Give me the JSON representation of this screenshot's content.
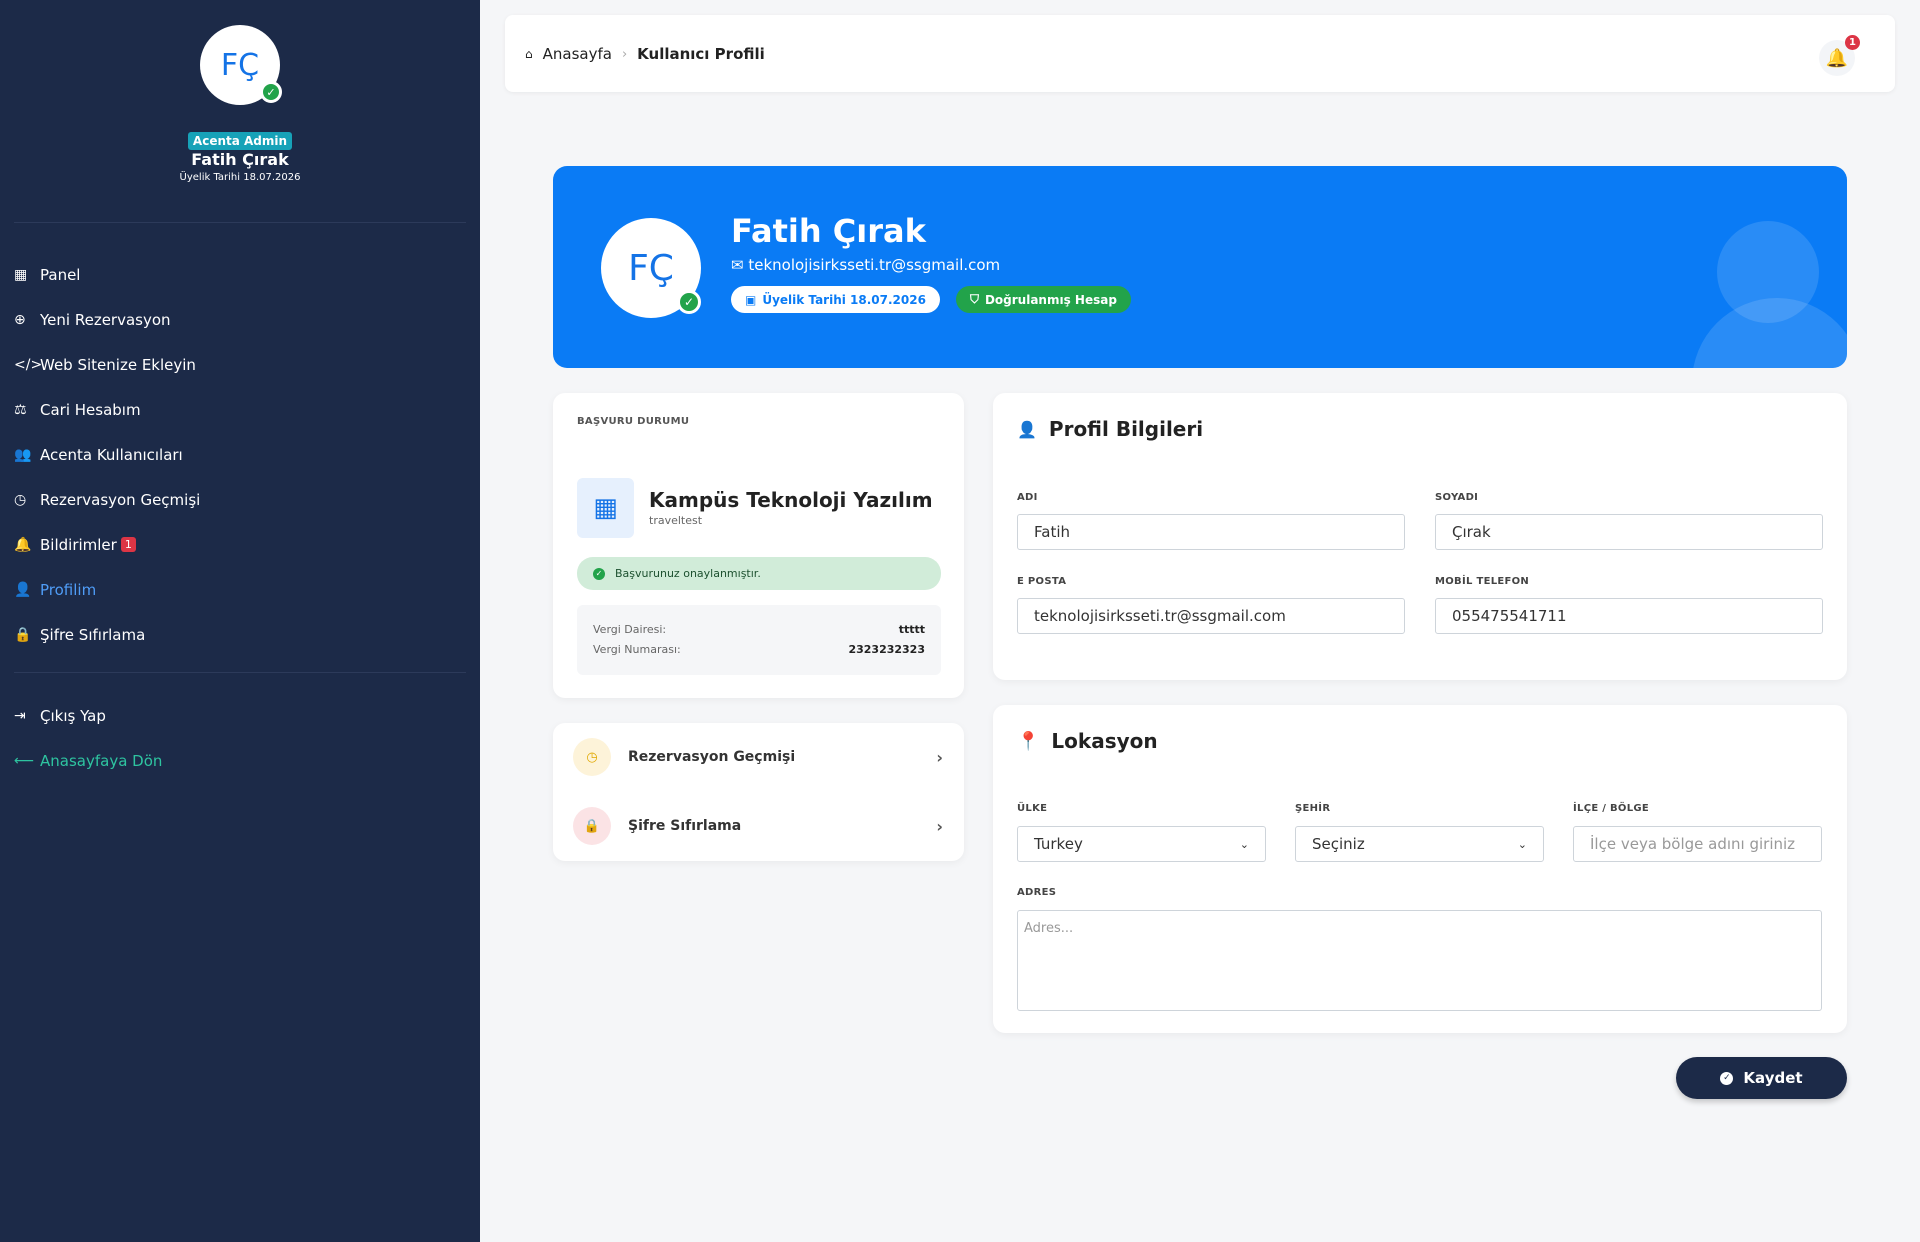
{
  "sidebar": {
    "avatar_initials": "FÇ",
    "role": "Acenta Admin",
    "name": "Fatih Çırak",
    "member_since": "Üyelik Tarihi 18.07.2026",
    "menu": [
      {
        "label": "Panel",
        "icon": "grid-icon"
      },
      {
        "label": "Yeni Rezervasyon",
        "icon": "plus-circle-icon"
      },
      {
        "label": "Web Sitenize Ekleyin",
        "icon": "code-icon"
      },
      {
        "label": "Cari Hesabım",
        "icon": "scale-icon"
      },
      {
        "label": "Acenta Kullanıcıları",
        "icon": "users-icon"
      },
      {
        "label": "Rezervasyon Geçmişi",
        "icon": "clock-icon"
      },
      {
        "label": "Bildirimler",
        "icon": "bell-icon",
        "badge": "1"
      },
      {
        "label": "Profilim",
        "icon": "user-icon",
        "active": true
      },
      {
        "label": "Şifre Sıfırlama",
        "icon": "lock-icon"
      }
    ],
    "menu_bottom": [
      {
        "label": "Çıkış Yap",
        "icon": "sign-out-icon"
      },
      {
        "label": "Anasayfaya Dön",
        "icon": "arrow-left-icon"
      }
    ]
  },
  "topbar": {
    "breadcrumb_home": "Anasayfa",
    "breadcrumb_current": "Kullanıcı Profili",
    "notification_count": "1"
  },
  "hero": {
    "initials": "FÇ",
    "name": "Fatih Çırak",
    "email": "teknolojisirksseti.tr@ssgmail.com",
    "member_since": "Üyelik Tarihi 18.07.2026",
    "verified": "Doğrulanmış Hesap"
  },
  "status": {
    "label": "BAŞVURU DURUMU",
    "company": "Kampüs Teknoloji Yazılım",
    "company_sub": "traveltest",
    "approved_text": "Başvurunuz onaylanmıştır.",
    "tax_office_label": "Vergi Dairesi:",
    "tax_office": "ttttt",
    "tax_number_label": "Vergi Numarası:",
    "tax_number": "2323232323"
  },
  "links": {
    "history": "Rezervasyon Geçmişi",
    "password": "Şifre Sıfırlama"
  },
  "profile": {
    "title": "Profil Bilgileri",
    "first_name_label": "ADI",
    "first_name": "Fatih",
    "last_name_label": "SOYADI",
    "last_name": "Çırak",
    "email_label": "E POSTA",
    "email": "teknolojisirksseti.tr@ssgmail.com",
    "phone_label": "MOBİL TELEFON",
    "phone": "055475541711"
  },
  "location": {
    "title": "Lokasyon",
    "country_label": "ÜLKE",
    "country": "Turkey",
    "city_label": "ŞEHİR",
    "city": "Seçiniz",
    "district_label": "İLÇE / BÖLGE",
    "district_placeholder": "İlçe veya bölge adını giriniz",
    "address_label": "ADRES",
    "address_placeholder": "Adres..."
  },
  "save_label": "Kaydet",
  "colors": {
    "sidebar": "#1c2a48",
    "accent": "#0a7bf5",
    "success": "#22a34a",
    "danger": "#dc3545"
  }
}
